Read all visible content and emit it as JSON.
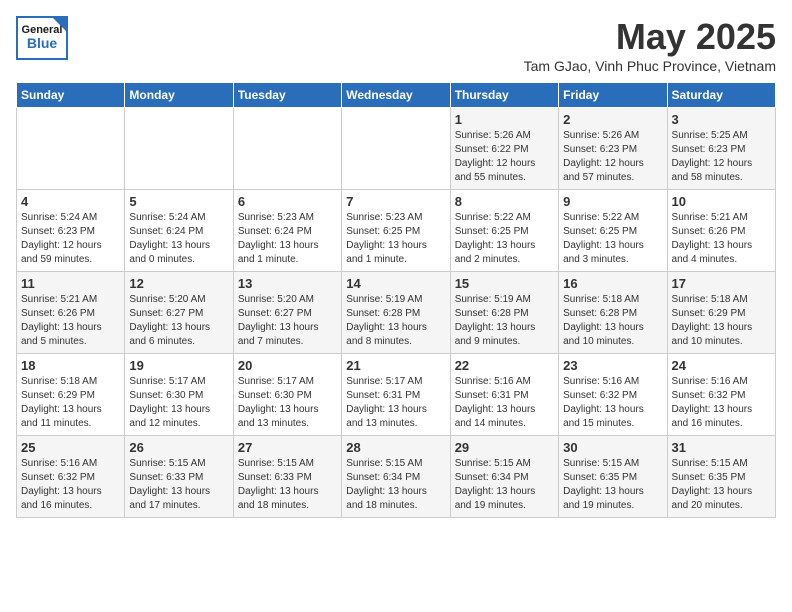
{
  "header": {
    "logo_general": "General",
    "logo_blue": "Blue",
    "month_title": "May 2025",
    "location": "Tam GJao, Vinh Phuc Province, Vietnam"
  },
  "days_of_week": [
    "Sunday",
    "Monday",
    "Tuesday",
    "Wednesday",
    "Thursday",
    "Friday",
    "Saturday"
  ],
  "weeks": [
    [
      {
        "day": "",
        "info": ""
      },
      {
        "day": "",
        "info": ""
      },
      {
        "day": "",
        "info": ""
      },
      {
        "day": "",
        "info": ""
      },
      {
        "day": "1",
        "info": "Sunrise: 5:26 AM\nSunset: 6:22 PM\nDaylight: 12 hours\nand 55 minutes."
      },
      {
        "day": "2",
        "info": "Sunrise: 5:26 AM\nSunset: 6:23 PM\nDaylight: 12 hours\nand 57 minutes."
      },
      {
        "day": "3",
        "info": "Sunrise: 5:25 AM\nSunset: 6:23 PM\nDaylight: 12 hours\nand 58 minutes."
      }
    ],
    [
      {
        "day": "4",
        "info": "Sunrise: 5:24 AM\nSunset: 6:23 PM\nDaylight: 12 hours\nand 59 minutes."
      },
      {
        "day": "5",
        "info": "Sunrise: 5:24 AM\nSunset: 6:24 PM\nDaylight: 13 hours\nand 0 minutes."
      },
      {
        "day": "6",
        "info": "Sunrise: 5:23 AM\nSunset: 6:24 PM\nDaylight: 13 hours\nand 1 minute."
      },
      {
        "day": "7",
        "info": "Sunrise: 5:23 AM\nSunset: 6:25 PM\nDaylight: 13 hours\nand 1 minute."
      },
      {
        "day": "8",
        "info": "Sunrise: 5:22 AM\nSunset: 6:25 PM\nDaylight: 13 hours\nand 2 minutes."
      },
      {
        "day": "9",
        "info": "Sunrise: 5:22 AM\nSunset: 6:25 PM\nDaylight: 13 hours\nand 3 minutes."
      },
      {
        "day": "10",
        "info": "Sunrise: 5:21 AM\nSunset: 6:26 PM\nDaylight: 13 hours\nand 4 minutes."
      }
    ],
    [
      {
        "day": "11",
        "info": "Sunrise: 5:21 AM\nSunset: 6:26 PM\nDaylight: 13 hours\nand 5 minutes."
      },
      {
        "day": "12",
        "info": "Sunrise: 5:20 AM\nSunset: 6:27 PM\nDaylight: 13 hours\nand 6 minutes."
      },
      {
        "day": "13",
        "info": "Sunrise: 5:20 AM\nSunset: 6:27 PM\nDaylight: 13 hours\nand 7 minutes."
      },
      {
        "day": "14",
        "info": "Sunrise: 5:19 AM\nSunset: 6:28 PM\nDaylight: 13 hours\nand 8 minutes."
      },
      {
        "day": "15",
        "info": "Sunrise: 5:19 AM\nSunset: 6:28 PM\nDaylight: 13 hours\nand 9 minutes."
      },
      {
        "day": "16",
        "info": "Sunrise: 5:18 AM\nSunset: 6:28 PM\nDaylight: 13 hours\nand 10 minutes."
      },
      {
        "day": "17",
        "info": "Sunrise: 5:18 AM\nSunset: 6:29 PM\nDaylight: 13 hours\nand 10 minutes."
      }
    ],
    [
      {
        "day": "18",
        "info": "Sunrise: 5:18 AM\nSunset: 6:29 PM\nDaylight: 13 hours\nand 11 minutes."
      },
      {
        "day": "19",
        "info": "Sunrise: 5:17 AM\nSunset: 6:30 PM\nDaylight: 13 hours\nand 12 minutes."
      },
      {
        "day": "20",
        "info": "Sunrise: 5:17 AM\nSunset: 6:30 PM\nDaylight: 13 hours\nand 13 minutes."
      },
      {
        "day": "21",
        "info": "Sunrise: 5:17 AM\nSunset: 6:31 PM\nDaylight: 13 hours\nand 13 minutes."
      },
      {
        "day": "22",
        "info": "Sunrise: 5:16 AM\nSunset: 6:31 PM\nDaylight: 13 hours\nand 14 minutes."
      },
      {
        "day": "23",
        "info": "Sunrise: 5:16 AM\nSunset: 6:32 PM\nDaylight: 13 hours\nand 15 minutes."
      },
      {
        "day": "24",
        "info": "Sunrise: 5:16 AM\nSunset: 6:32 PM\nDaylight: 13 hours\nand 16 minutes."
      }
    ],
    [
      {
        "day": "25",
        "info": "Sunrise: 5:16 AM\nSunset: 6:32 PM\nDaylight: 13 hours\nand 16 minutes."
      },
      {
        "day": "26",
        "info": "Sunrise: 5:15 AM\nSunset: 6:33 PM\nDaylight: 13 hours\nand 17 minutes."
      },
      {
        "day": "27",
        "info": "Sunrise: 5:15 AM\nSunset: 6:33 PM\nDaylight: 13 hours\nand 18 minutes."
      },
      {
        "day": "28",
        "info": "Sunrise: 5:15 AM\nSunset: 6:34 PM\nDaylight: 13 hours\nand 18 minutes."
      },
      {
        "day": "29",
        "info": "Sunrise: 5:15 AM\nSunset: 6:34 PM\nDaylight: 13 hours\nand 19 minutes."
      },
      {
        "day": "30",
        "info": "Sunrise: 5:15 AM\nSunset: 6:35 PM\nDaylight: 13 hours\nand 19 minutes."
      },
      {
        "day": "31",
        "info": "Sunrise: 5:15 AM\nSunset: 6:35 PM\nDaylight: 13 hours\nand 20 minutes."
      }
    ]
  ]
}
